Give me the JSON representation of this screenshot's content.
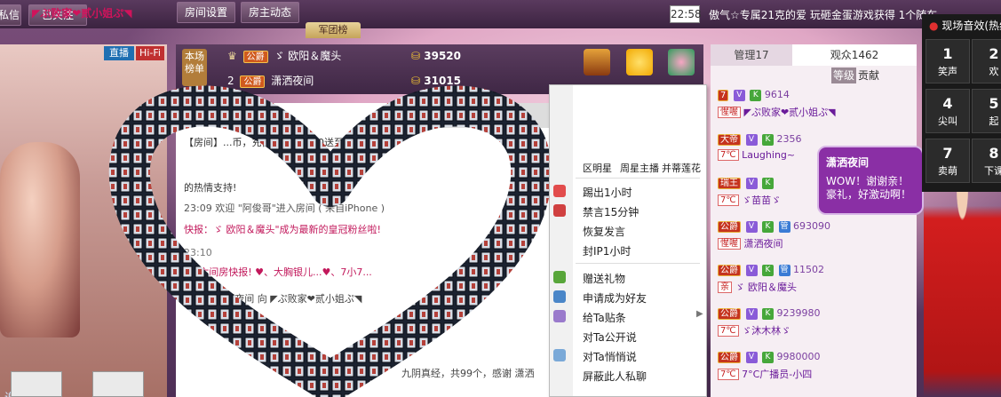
{
  "topbar": {
    "private_msg": "私信",
    "follow": "已关注",
    "room_settings": "房间设置",
    "host_news": "房主动态",
    "time": "22:58",
    "marquee": "傲气☆专属21克的爱 玩砸金蛋游戏获得 1个随车",
    "army_tab": "军团榜"
  },
  "video": {
    "live": "直播",
    "hifi": "Hi-Fi",
    "subtitle": "谢...红包。。。。"
  },
  "ranking": {
    "label": "本场榜单",
    "rows": [
      {
        "rank": "1",
        "badge": "公爵",
        "name": "ゞ 欧阳＆魔头",
        "score": "39520"
      },
      {
        "rank": "2",
        "badge": "公爵",
        "name": "潇洒夜间",
        "score": "31015"
      }
    ]
  },
  "chat": {
    "tab_game": "游戏",
    "lines": [
      {
        "text": "【房间】...币，充值500...2000送至尊VIP。优",
        "color": "#333"
      },
      {
        "text": "的热情支持!",
        "color": "#333"
      },
      {
        "text": "23:09 欢迎 \"阿俊哥\"进入房间 ( 来自iPhone )",
        "color": "#555"
      },
      {
        "text": "快报：ゞ 欧阳＆魔头\"成为最新的皇冠粉丝啦!",
        "color": "#c2185b"
      },
      {
        "text": "23:10",
        "color": "#777"
      },
      {
        "text": "六间房快报! ♥、大胸银儿...♥、7小7...",
        "color": "#c2185b"
      },
      {
        "text": "23:10 潇洒夜间 向 ◤ぷ败家❤贰小姐ぷ◥",
        "color": "#444"
      },
      {
        "text": "九阴真经，共99个，感谢 潇洒",
        "color": "#444"
      }
    ]
  },
  "menu": {
    "title": "◤ぷ败家❤贰小姐ぷ◥",
    "icons": [
      {
        "label": "区明星"
      },
      {
        "label": "周星主播"
      },
      {
        "label": "并蒂莲花"
      }
    ],
    "items_group1": [
      "踢出1小时",
      "禁言15分钟",
      "恢复发言",
      "封IP1小时"
    ],
    "items_group2": [
      "赠送礼物",
      "申请成为好友",
      "给Ta贴条",
      "对Ta公开说",
      "对Ta悄悄说",
      "屏蔽此人私聊"
    ]
  },
  "panel": {
    "tab_admin": "管理17",
    "tab_audience": "观众1462",
    "level_label": "等级",
    "contrib_label": "贡献",
    "users": [
      {
        "lvl": "7",
        "num": "9614",
        "name": "◤ぷ败家❤贰小姐ぷ◥",
        "temp": "惺喔"
      },
      {
        "lvl": "大帝",
        "num": "2356",
        "name": "Laughing~",
        "temp": "7℃"
      },
      {
        "lvl": "瑞王",
        "num": "",
        "name": "ゞ苗苗ゞ",
        "temp": "7℃"
      },
      {
        "lvl": "公爵",
        "num": "693090",
        "name": "潇洒夜间",
        "temp": "惺喔"
      },
      {
        "lvl": "公爵",
        "num": "11502",
        "name": "ゞ 欧阳＆魔头",
        "temp": "亲"
      },
      {
        "lvl": "公爵",
        "num": "9239980",
        "name": "ゞ沐木林ゞ",
        "temp": "7℃"
      },
      {
        "lvl": "公爵",
        "num": "9980000",
        "name": "7°C广播员-小四",
        "temp": "7℃"
      }
    ]
  },
  "bubble": {
    "name": "潇洒夜间",
    "text": "WOW！谢谢亲！豪礼，好激动啊！"
  },
  "sfx": {
    "title": "现场音效(热线)",
    "buttons": [
      {
        "n": "1",
        "t": "笑声"
      },
      {
        "n": "2",
        "t": "欢"
      },
      {
        "n": "4",
        "t": "尖叫"
      },
      {
        "n": "5",
        "t": "起"
      },
      {
        "n": "7",
        "t": "卖萌"
      },
      {
        "n": "8",
        "t": "下课"
      }
    ]
  },
  "colors": {
    "accent": "#d0135b",
    "panel_bg": "#f6eef3",
    "topbar": "#4a2d4e"
  }
}
